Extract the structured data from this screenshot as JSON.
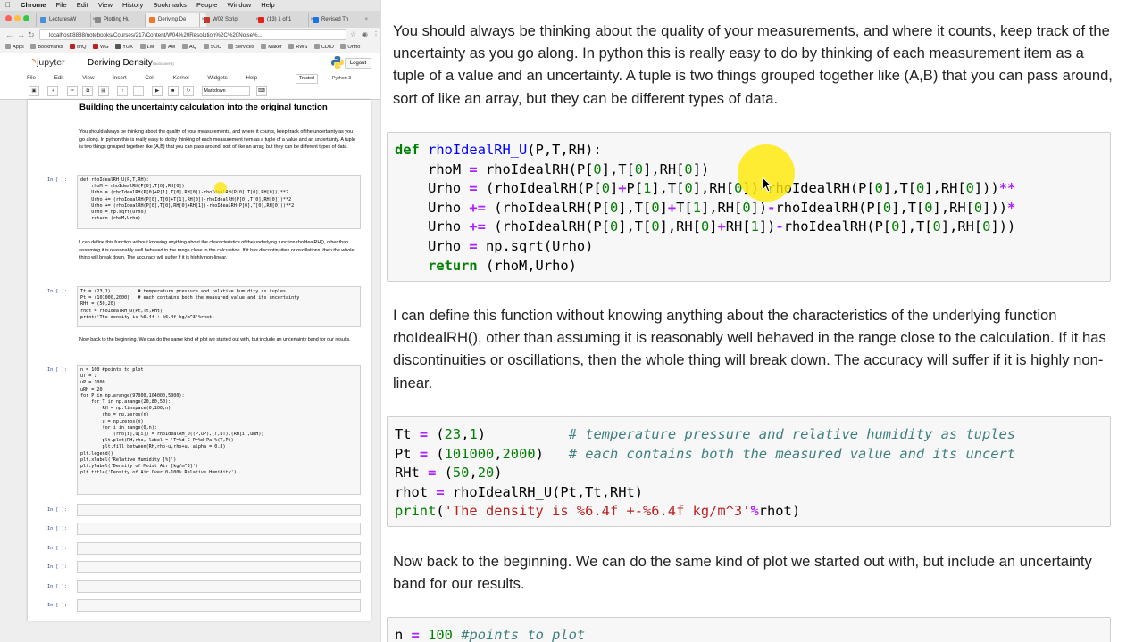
{
  "mac_menubar": {
    "apple": "",
    "app": "Chrome",
    "items": [
      "File",
      "Edit",
      "View",
      "History",
      "Bookmarks",
      "People",
      "Window",
      "Help"
    ]
  },
  "browser": {
    "tabs": [
      {
        "label": "Lectures/W",
        "color": "#4a90d9"
      },
      {
        "label": "Plotting Hu",
        "color": "#888888"
      },
      {
        "label": "Deriving De",
        "color": "#f37726",
        "active": true
      },
      {
        "label": "W02 Script",
        "color": "#c0392b"
      },
      {
        "label": "(13) 1 of 1",
        "color": "#e62117"
      },
      {
        "label": "Revised Th",
        "color": "#1a73e8"
      }
    ],
    "url": "localhost:8888/notebooks/Courses/217/Content/W04%20Resolution%2C%20Noise%...",
    "bookmarks": [
      "Apps",
      "Bookmarks",
      "onQ",
      "WG",
      "YGK",
      "LM",
      "AM",
      "AQ",
      "SOC",
      "Services",
      "Maker",
      "RWS",
      "CDIO",
      "Ortho"
    ]
  },
  "jupyter": {
    "logo_text": "jupyter",
    "notebook_title": "Deriving Density",
    "autosave": "(autosaved)",
    "logout": "Logout",
    "menu": [
      "File",
      "Edit",
      "View",
      "Insert",
      "Cell",
      "Kernel",
      "Widgets",
      "Help"
    ],
    "trusted": "Trusted",
    "kernel": "Python 3",
    "cell_type": "Markdown"
  },
  "notebook": {
    "heading": "Building the uncertainty calculation into the original function",
    "heading_partial": "function",
    "intro_text": "You should always be thinking about the quality of your measurements, and where it counts, keep track of the uncertainty as you go along. In python this is really easy to do by thinking of each measurement item as a tuple of a value and an uncertainty. A tuple is two things grouped together like (A,B) that you can pass around, sort of like an array, but they can be different types of data.",
    "prompt_empty": "In [ ]:",
    "code1": "def rhoIdealRH_U(P,T,RH):\n    rhoM = rhoIdealRH(P[0],T[0],RH[0])\n    Urho = (rhoIdealRH(P[0]+P[1],T[0],RH[0])-rhoIdealRH(P[0],T[0],RH[0]))**2\n    Urho += (rhoIdealRH(P[0],T[0]+T[1],RH[0])-rhoIdealRH(P[0],T[0],RH[0]))**2\n    Urho += (rhoIdealRH(P[0],T[0],RH[0]+RH[1])-rhoIdealRH(P[0],T[0],RH[0]))**2\n    Urho = np.sqrt(Urho)\n    return (rhoM,Urho)",
    "text2": "I can define this function without knowing anything about the characteristics of the underlying function rhoIdealRH(), other than assuming it is reasonably well behaved in the range close to the calculation. If it has discontinuities or oscillations, then the whole thing will break down. The accuracy will suffer if it is highly non-linear.",
    "code2": "Tt = (23,1)          # temperature pressure and relative humidity as tuples\nPt = (101000,2000)   # each contains both the measured value and its uncertainty\nRHt = (50,20)\nrhot = rhoIdealRH_U(Pt,Tt,RHt)\nprint('The density is %6.4f +-%6.4f kg/m^3'%rhot)",
    "text3": "Now back to the beginning. We can do the same kind of plot we started out with, but include an uncertainty band for our results.",
    "code3": "n = 100 #points to plot\nuT = 1\nuP = 1000\nuRH = 20\nfor P in np.arange(97000,104000,5000):\n    for T in np.arange(20,80,50):\n        RH = np.linspace(0,100,n)\n        rho = np.zeros(n)\n        u = np.zeros(n)\n        for i in range(0,n):\n            (rho[i],u[i]) = rhoIdealRH_U((P,uP),(T,uT),(RH[i],uRH))\n        plt.plot(RH,rho, label = 'T=%d C P=%d Pa'%(T,P))\n        plt.fill_between(RH,rho-u,rho+u, alpha = 0.3)\nplt.legend()\nplt.xlabel('Relative Humidity [%]')\nplt.ylabel('Density of Moist Air [kg/m^3]')\nplt.title('Density of Air Over 0-100% Relative Humidity')",
    "empty_cell_count": 6
  },
  "zoom": {
    "code1_lines": [
      "def rhoIdealRH_U(P,T,RH):",
      "    rhoM = rhoIdealRH(P[0],T[0],RH[0])",
      "    Urho = (rhoIdealRH(P[0]+P[1],T[0],RH[0])-rhoIdealRH(P[0],T[0],RH[0]))**",
      "    Urho += (rhoIdealRH(P[0],T[0]+T[1],RH[0])-rhoIdealRH(P[0],T[0],RH[0]))*",
      "    Urho += (rhoIdealRH(P[0],T[0],RH[0]+RH[1])-rhoIdealRH(P[0],T[0],RH[0]))",
      "    Urho = np.sqrt(Urho)",
      "    return (rhoM,Urho)"
    ],
    "code2_lines": [
      "Tt = (23,1)          # temperature pressure and relative humidity as tuples",
      "Pt = (101000,2000)   # each contains both the measured value and its uncert",
      "RHt = (50,20)",
      "rhot = rhoIdealRH_U(Pt,Tt,RHt)",
      "print('The density is %6.4f +-%6.4f kg/m^3'%rhot)"
    ],
    "code3_first_line": "n = 100 #points to plot"
  },
  "colors": {
    "keyword": "#008000",
    "function_name": "#0000ff",
    "operator": "#aa22ff",
    "string": "#ba2121",
    "comment": "#408080",
    "prompt": "#303f9f",
    "highlight": "#ffe800",
    "jupyter_orange": "#f37726"
  }
}
